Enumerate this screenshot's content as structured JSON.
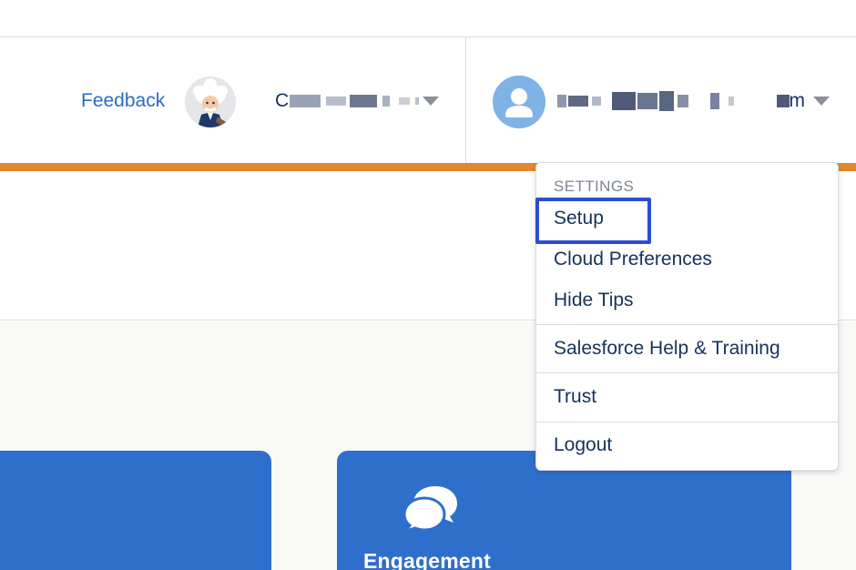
{
  "header": {
    "feedback_label": "Feedback",
    "org_name": "C",
    "user_name_tail": "m"
  },
  "icons": {
    "einstein_avatar": "einstein-avatar-icon",
    "org_caret": "chevron-down-icon",
    "user_avatar": "user-icon",
    "user_caret": "chevron-down-icon",
    "engagement": "chat-bubbles-icon"
  },
  "colors": {
    "accent_orange": "#e0892e",
    "link_blue": "#2a6bc7",
    "card_blue": "#2f6fcc",
    "highlight_blue": "#2a4ed1",
    "text_navy": "#16325c"
  },
  "user_menu": {
    "section_label": "SETTINGS",
    "items": [
      {
        "label": "Setup"
      },
      {
        "label": "Cloud Preferences"
      },
      {
        "label": "Hide Tips"
      },
      {
        "label": "Salesforce Help & Training"
      },
      {
        "label": "Trust"
      },
      {
        "label": "Logout"
      }
    ]
  },
  "cards": {
    "engagement_title": "Engagement"
  }
}
